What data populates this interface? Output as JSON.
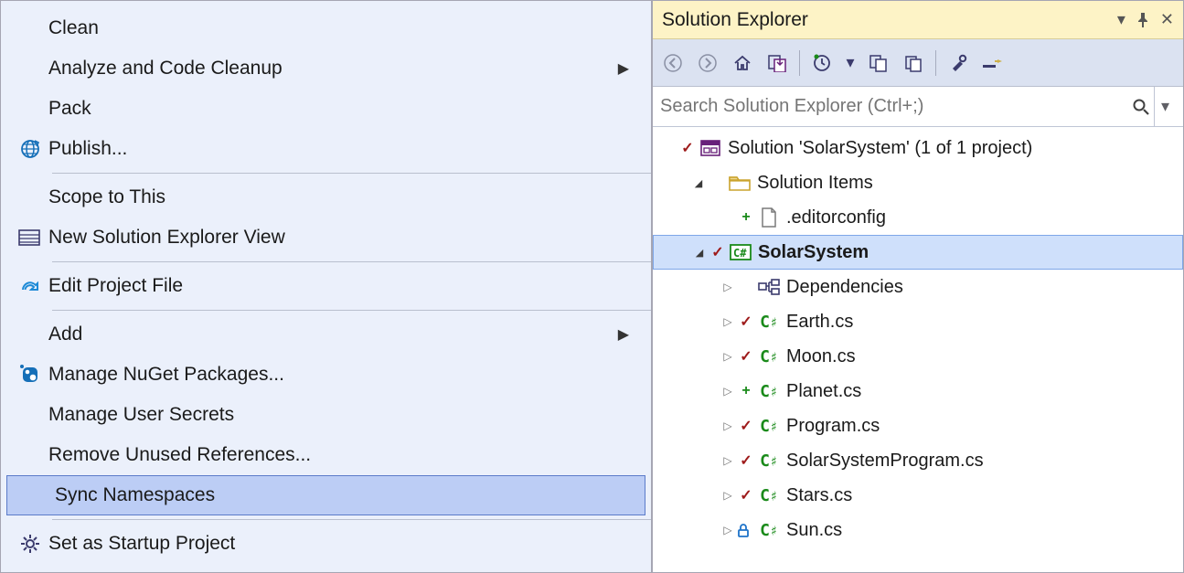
{
  "context_menu": {
    "items": [
      {
        "label": "Clean",
        "icon": null,
        "submenu": false
      },
      {
        "label": "Analyze and Code Cleanup",
        "icon": null,
        "submenu": true
      },
      {
        "label": "Pack",
        "icon": null,
        "submenu": false
      },
      {
        "label": "Publish...",
        "icon": "globe",
        "submenu": false,
        "sep_after": true
      },
      {
        "label": "Scope to This",
        "icon": null,
        "submenu": false
      },
      {
        "label": "New Solution Explorer View",
        "icon": "newview",
        "submenu": false,
        "sep_after": true
      },
      {
        "label": "Edit Project File",
        "icon": "redo",
        "submenu": false,
        "sep_after": true
      },
      {
        "label": "Add",
        "icon": null,
        "submenu": true
      },
      {
        "label": "Manage NuGet Packages...",
        "icon": "nuget",
        "submenu": false
      },
      {
        "label": "Manage User Secrets",
        "icon": null,
        "submenu": false
      },
      {
        "label": "Remove Unused References...",
        "icon": null,
        "submenu": false
      },
      {
        "label": "Sync Namespaces",
        "icon": null,
        "submenu": false,
        "highlighted": true,
        "sep_after": true
      },
      {
        "label": "Set as Startup Project",
        "icon": "gear",
        "submenu": false
      }
    ]
  },
  "solution_explorer": {
    "title": "Solution Explorer",
    "search_placeholder": "Search Solution Explorer (Ctrl+;)",
    "tree": [
      {
        "depth": 0,
        "expander": "none",
        "status": "check",
        "icon": "solution",
        "label": "Solution 'SolarSystem' (1 of 1 project)"
      },
      {
        "depth": 1,
        "expander": "open",
        "status": "none",
        "icon": "folder",
        "label": "Solution Items"
      },
      {
        "depth": 2,
        "expander": "none",
        "status": "plus",
        "icon": "file",
        "label": ".editorconfig"
      },
      {
        "depth": 1,
        "expander": "open",
        "status": "check",
        "icon": "csproj",
        "label": "SolarSystem",
        "selected": true,
        "bold": true
      },
      {
        "depth": 2,
        "expander": "closed",
        "status": "none",
        "icon": "deps",
        "label": "Dependencies"
      },
      {
        "depth": 2,
        "expander": "closed",
        "status": "check",
        "icon": "cs",
        "label": "Earth.cs"
      },
      {
        "depth": 2,
        "expander": "closed",
        "status": "check",
        "icon": "cs",
        "label": "Moon.cs"
      },
      {
        "depth": 2,
        "expander": "closed",
        "status": "plus",
        "icon": "cs",
        "label": "Planet.cs"
      },
      {
        "depth": 2,
        "expander": "closed",
        "status": "check",
        "icon": "cs",
        "label": "Program.cs"
      },
      {
        "depth": 2,
        "expander": "closed",
        "status": "check",
        "icon": "cs",
        "label": "SolarSystemProgram.cs"
      },
      {
        "depth": 2,
        "expander": "closed",
        "status": "check",
        "icon": "cs",
        "label": "Stars.cs"
      },
      {
        "depth": 2,
        "expander": "closed",
        "status": "lock",
        "icon": "cs",
        "label": "Sun.cs"
      }
    ]
  }
}
